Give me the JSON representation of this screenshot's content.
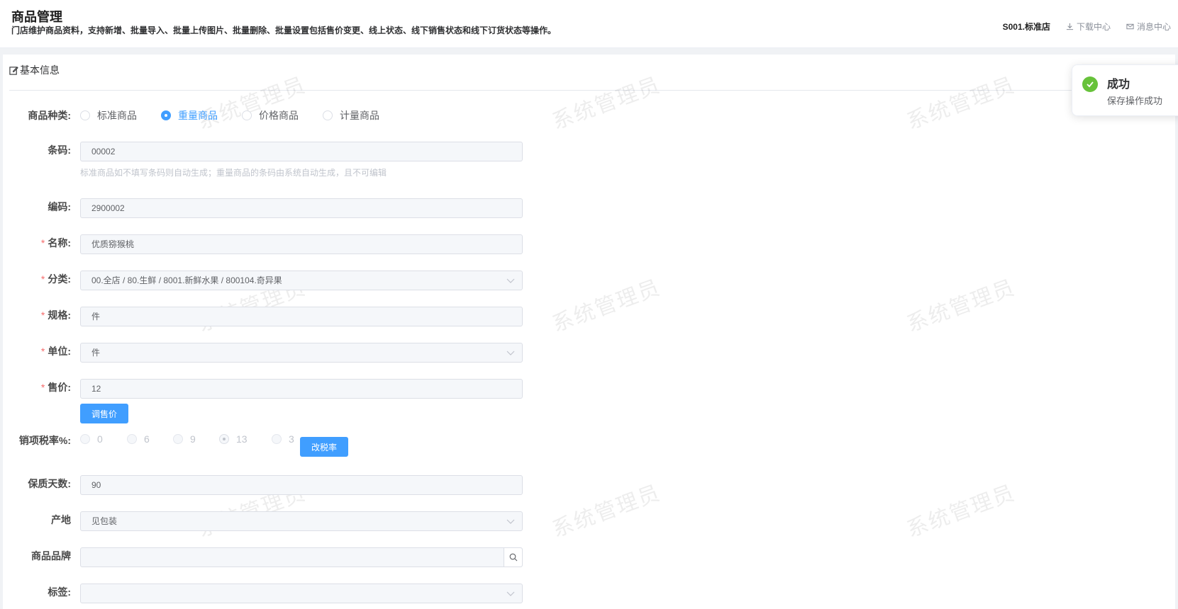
{
  "header": {
    "title": "商品管理",
    "description": "门店维护商品资料，支持新增、批量导入、批量上传图片、批量删除、批量设置包括售价变更、线上状态、线下销售状态和线下订货状态等操作。",
    "store": "S001.标准店",
    "download_center": "下载中心",
    "message_center": "消息中心"
  },
  "section": {
    "title": "基本信息"
  },
  "watermark": "系统管理员",
  "form": {
    "product_type": {
      "label": "商品种类:",
      "options": [
        "标准商品",
        "重量商品",
        "价格商品",
        "计量商品"
      ],
      "selected": "重量商品"
    },
    "barcode": {
      "label": "条码:",
      "value": "00002",
      "hint": "标准商品如不填写条码则自动生成；重量商品的条码由系统自动生成，且不可编辑"
    },
    "code": {
      "label": "编码:",
      "value": "2900002"
    },
    "name": {
      "label": "名称:",
      "value": "优质猕猴桃"
    },
    "category": {
      "label": "分类:",
      "value": "00.全店 / 80.生鲜 / 8001.新鲜水果 / 800104.奇异果"
    },
    "spec": {
      "label": "规格:",
      "value": "件"
    },
    "unit": {
      "label": "单位:",
      "value": "件"
    },
    "price": {
      "label": "售价:",
      "value": "12",
      "adjust_button": "调售价"
    },
    "tax_rate": {
      "label": "销项税率%:",
      "options": [
        "0",
        "6",
        "9",
        "13",
        "3"
      ],
      "selected": "13",
      "change_button": "改税率"
    },
    "shelf_life": {
      "label": "保质天数:",
      "value": "90"
    },
    "origin": {
      "label": "产地",
      "value": "见包装"
    },
    "brand": {
      "label": "商品品牌",
      "value": ""
    },
    "tags": {
      "label": "标签:",
      "value": ""
    }
  },
  "toast": {
    "title": "成功",
    "message": "保存操作成功"
  },
  "colors": {
    "primary": "#409eff",
    "success": "#67c23a",
    "required": "#f56c6c"
  }
}
